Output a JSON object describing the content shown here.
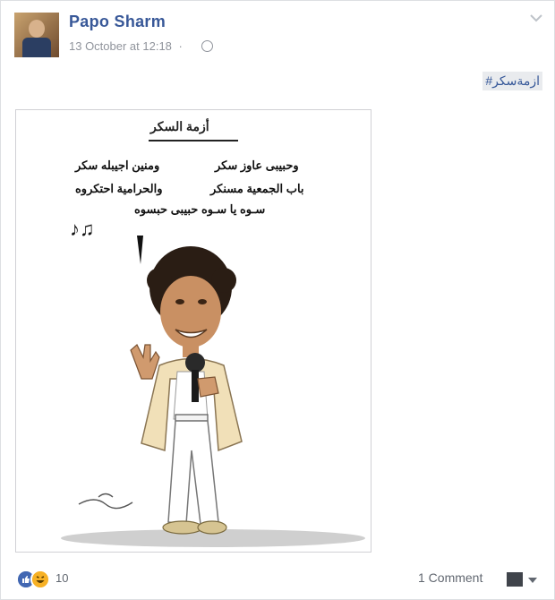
{
  "post": {
    "author": "Papo Sharm",
    "timestamp": "13 October at 12:18",
    "separator": "·",
    "hashtag": "#ازمةسكر"
  },
  "cartoon": {
    "title": "أزمة السكر",
    "lines": [
      "وحبيبى عاوز سكر",
      "ومنين اجيبله سكر",
      "باب الجمعية مسنكر",
      "والحرامية احتكروه",
      "سـوه يا سـوه حبيبى حبسوه"
    ],
    "notes": "♪♫"
  },
  "footer": {
    "reaction_count": "10",
    "comments": "1 Comment"
  },
  "colors": {
    "link": "#385898",
    "muted": "#90949c",
    "like": "#4267b2",
    "haha": "#f7b125"
  }
}
